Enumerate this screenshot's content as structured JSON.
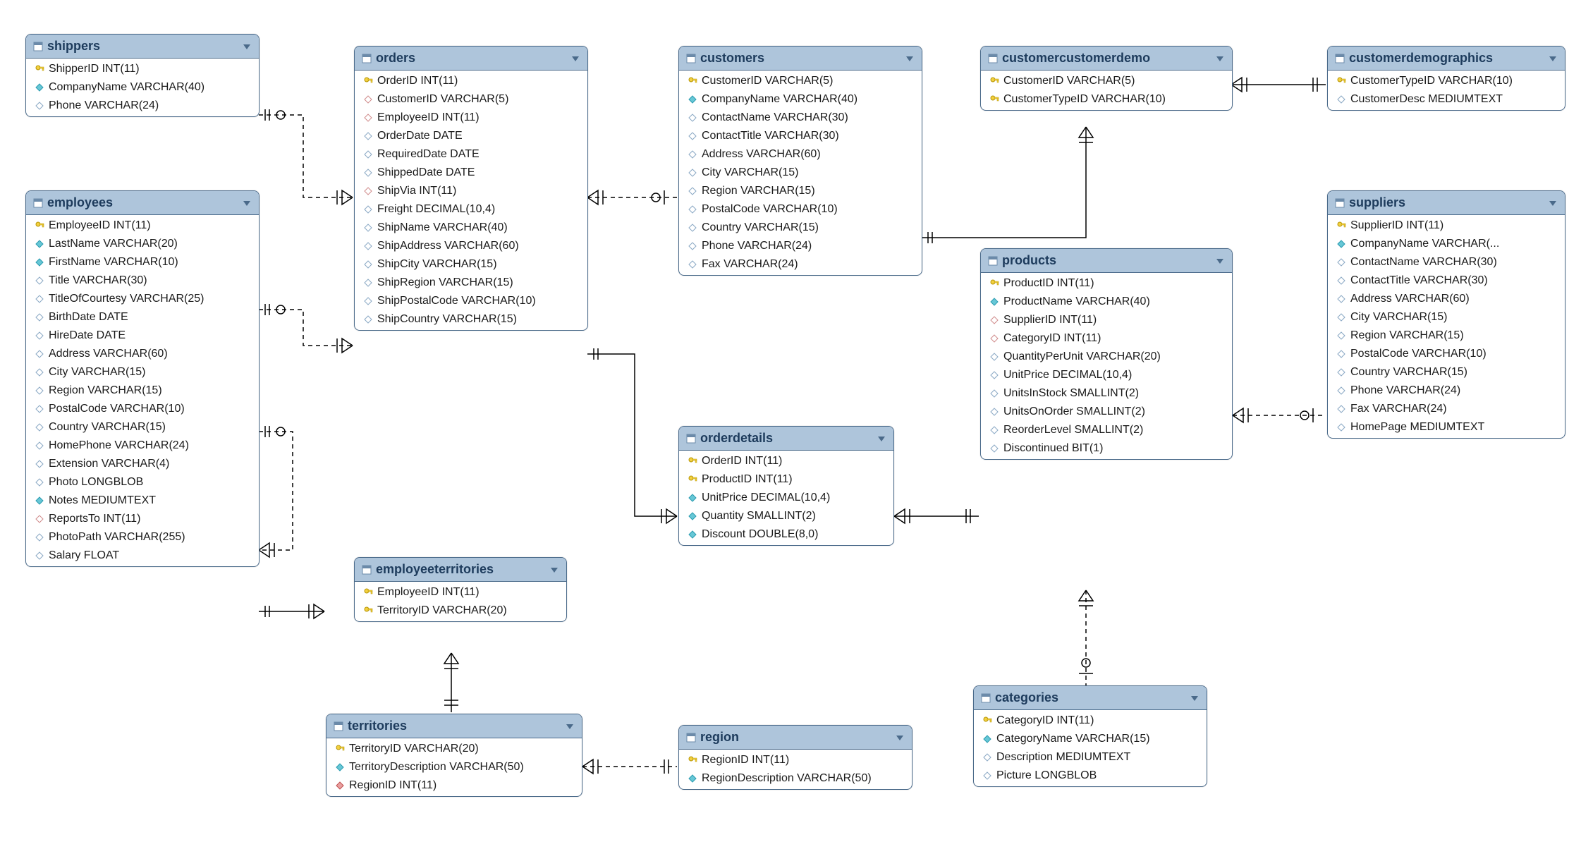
{
  "tables": {
    "shippers": {
      "title": "shippers",
      "columns": [
        {
          "name": "ShipperID INT(11)",
          "icon": "key"
        },
        {
          "name": "CompanyName VARCHAR(40)",
          "icon": "filled"
        },
        {
          "name": "Phone VARCHAR(24)",
          "icon": "outline"
        }
      ]
    },
    "employees": {
      "title": "employees",
      "columns": [
        {
          "name": "EmployeeID INT(11)",
          "icon": "key"
        },
        {
          "name": "LastName VARCHAR(20)",
          "icon": "filled"
        },
        {
          "name": "FirstName VARCHAR(10)",
          "icon": "filled"
        },
        {
          "name": "Title VARCHAR(30)",
          "icon": "outline"
        },
        {
          "name": "TitleOfCourtesy VARCHAR(25)",
          "icon": "outline"
        },
        {
          "name": "BirthDate DATE",
          "icon": "outline"
        },
        {
          "name": "HireDate DATE",
          "icon": "outline"
        },
        {
          "name": "Address VARCHAR(60)",
          "icon": "outline"
        },
        {
          "name": "City VARCHAR(15)",
          "icon": "outline"
        },
        {
          "name": "Region VARCHAR(15)",
          "icon": "outline"
        },
        {
          "name": "PostalCode VARCHAR(10)",
          "icon": "outline"
        },
        {
          "name": "Country VARCHAR(15)",
          "icon": "outline"
        },
        {
          "name": "HomePhone VARCHAR(24)",
          "icon": "outline"
        },
        {
          "name": "Extension VARCHAR(4)",
          "icon": "outline"
        },
        {
          "name": "Photo LONGBLOB",
          "icon": "outline"
        },
        {
          "name": "Notes MEDIUMTEXT",
          "icon": "filled"
        },
        {
          "name": "ReportsTo INT(11)",
          "icon": "fk"
        },
        {
          "name": "PhotoPath VARCHAR(255)",
          "icon": "outline"
        },
        {
          "name": "Salary FLOAT",
          "icon": "outline"
        }
      ]
    },
    "orders": {
      "title": "orders",
      "columns": [
        {
          "name": "OrderID INT(11)",
          "icon": "key"
        },
        {
          "name": "CustomerID VARCHAR(5)",
          "icon": "fk"
        },
        {
          "name": "EmployeeID INT(11)",
          "icon": "fk"
        },
        {
          "name": "OrderDate DATE",
          "icon": "outline"
        },
        {
          "name": "RequiredDate DATE",
          "icon": "outline"
        },
        {
          "name": "ShippedDate DATE",
          "icon": "outline"
        },
        {
          "name": "ShipVia INT(11)",
          "icon": "fk"
        },
        {
          "name": "Freight DECIMAL(10,4)",
          "icon": "outline"
        },
        {
          "name": "ShipName VARCHAR(40)",
          "icon": "outline"
        },
        {
          "name": "ShipAddress VARCHAR(60)",
          "icon": "outline"
        },
        {
          "name": "ShipCity VARCHAR(15)",
          "icon": "outline"
        },
        {
          "name": "ShipRegion VARCHAR(15)",
          "icon": "outline"
        },
        {
          "name": "ShipPostalCode VARCHAR(10)",
          "icon": "outline"
        },
        {
          "name": "ShipCountry VARCHAR(15)",
          "icon": "outline"
        }
      ]
    },
    "customers": {
      "title": "customers",
      "columns": [
        {
          "name": "CustomerID VARCHAR(5)",
          "icon": "key"
        },
        {
          "name": "CompanyName VARCHAR(40)",
          "icon": "filled"
        },
        {
          "name": "ContactName VARCHAR(30)",
          "icon": "outline"
        },
        {
          "name": "ContactTitle VARCHAR(30)",
          "icon": "outline"
        },
        {
          "name": "Address VARCHAR(60)",
          "icon": "outline"
        },
        {
          "name": "City VARCHAR(15)",
          "icon": "outline"
        },
        {
          "name": "Region VARCHAR(15)",
          "icon": "outline"
        },
        {
          "name": "PostalCode VARCHAR(10)",
          "icon": "outline"
        },
        {
          "name": "Country VARCHAR(15)",
          "icon": "outline"
        },
        {
          "name": "Phone VARCHAR(24)",
          "icon": "outline"
        },
        {
          "name": "Fax VARCHAR(24)",
          "icon": "outline"
        }
      ]
    },
    "customercustomerdemo": {
      "title": "customercustomerdemo",
      "columns": [
        {
          "name": "CustomerID VARCHAR(5)",
          "icon": "key"
        },
        {
          "name": "CustomerTypeID VARCHAR(10)",
          "icon": "key"
        }
      ]
    },
    "customerdemographics": {
      "title": "customerdemographics",
      "columns": [
        {
          "name": "CustomerTypeID VARCHAR(10)",
          "icon": "key"
        },
        {
          "name": "CustomerDesc MEDIUMTEXT",
          "icon": "outline"
        }
      ]
    },
    "suppliers": {
      "title": "suppliers",
      "columns": [
        {
          "name": "SupplierID INT(11)",
          "icon": "key"
        },
        {
          "name": "CompanyName VARCHAR(...",
          "icon": "filled"
        },
        {
          "name": "ContactName VARCHAR(30)",
          "icon": "outline"
        },
        {
          "name": "ContactTitle VARCHAR(30)",
          "icon": "outline"
        },
        {
          "name": "Address VARCHAR(60)",
          "icon": "outline"
        },
        {
          "name": "City VARCHAR(15)",
          "icon": "outline"
        },
        {
          "name": "Region VARCHAR(15)",
          "icon": "outline"
        },
        {
          "name": "PostalCode VARCHAR(10)",
          "icon": "outline"
        },
        {
          "name": "Country VARCHAR(15)",
          "icon": "outline"
        },
        {
          "name": "Phone VARCHAR(24)",
          "icon": "outline"
        },
        {
          "name": "Fax VARCHAR(24)",
          "icon": "outline"
        },
        {
          "name": "HomePage MEDIUMTEXT",
          "icon": "outline"
        }
      ]
    },
    "products": {
      "title": "products",
      "columns": [
        {
          "name": "ProductID INT(11)",
          "icon": "key"
        },
        {
          "name": "ProductName VARCHAR(40)",
          "icon": "filled"
        },
        {
          "name": "SupplierID INT(11)",
          "icon": "fk"
        },
        {
          "name": "CategoryID INT(11)",
          "icon": "fk"
        },
        {
          "name": "QuantityPerUnit VARCHAR(20)",
          "icon": "outline"
        },
        {
          "name": "UnitPrice DECIMAL(10,4)",
          "icon": "outline"
        },
        {
          "name": "UnitsInStock SMALLINT(2)",
          "icon": "outline"
        },
        {
          "name": "UnitsOnOrder SMALLINT(2)",
          "icon": "outline"
        },
        {
          "name": "ReorderLevel SMALLINT(2)",
          "icon": "outline"
        },
        {
          "name": "Discontinued BIT(1)",
          "icon": "outline"
        }
      ]
    },
    "orderdetails": {
      "title": "orderdetails",
      "columns": [
        {
          "name": "OrderID INT(11)",
          "icon": "key"
        },
        {
          "name": "ProductID INT(11)",
          "icon": "key"
        },
        {
          "name": "UnitPrice DECIMAL(10,4)",
          "icon": "filled"
        },
        {
          "name": "Quantity SMALLINT(2)",
          "icon": "filled"
        },
        {
          "name": "Discount DOUBLE(8,0)",
          "icon": "filled"
        }
      ]
    },
    "categories": {
      "title": "categories",
      "columns": [
        {
          "name": "CategoryID INT(11)",
          "icon": "key"
        },
        {
          "name": "CategoryName VARCHAR(15)",
          "icon": "filled"
        },
        {
          "name": "Description MEDIUMTEXT",
          "icon": "outline"
        },
        {
          "name": "Picture LONGBLOB",
          "icon": "outline"
        }
      ]
    },
    "employeeterritories": {
      "title": "employeeterritories",
      "columns": [
        {
          "name": "EmployeeID INT(11)",
          "icon": "key"
        },
        {
          "name": "TerritoryID VARCHAR(20)",
          "icon": "key"
        }
      ]
    },
    "territories": {
      "title": "territories",
      "columns": [
        {
          "name": "TerritoryID VARCHAR(20)",
          "icon": "key"
        },
        {
          "name": "TerritoryDescription VARCHAR(50)",
          "icon": "filled"
        },
        {
          "name": "RegionID INT(11)",
          "icon": "fkred"
        }
      ]
    },
    "region": {
      "title": "region",
      "columns": [
        {
          "name": "RegionID INT(11)",
          "icon": "key"
        },
        {
          "name": "RegionDescription VARCHAR(50)",
          "icon": "filled"
        }
      ]
    }
  }
}
